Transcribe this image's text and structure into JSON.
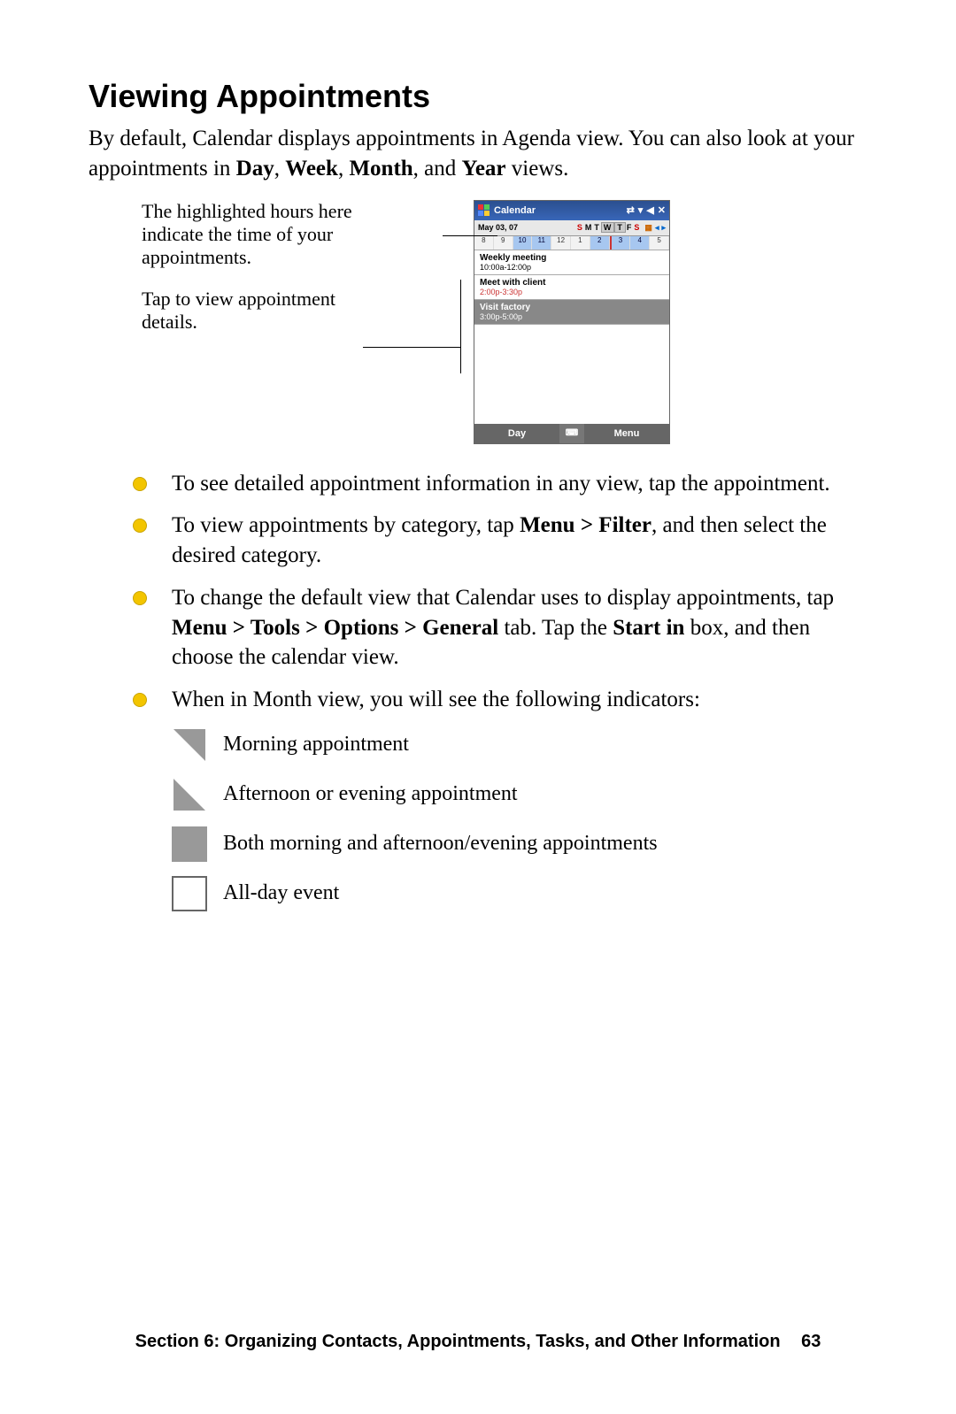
{
  "heading": "Viewing Appointments",
  "intro": {
    "pre": "By default, Calendar displays appointments in Agenda view. You can also look at your appointments in ",
    "b1": "Day",
    "c1": ", ",
    "b2": "Week",
    "c2": ", ",
    "b3": "Month",
    "c3": ", and ",
    "b4": "Year",
    "post": " views."
  },
  "callouts": {
    "a": "The highlighted hours here indicate the time of your appointments.",
    "b": "Tap to view appointment details."
  },
  "phone": {
    "title": "Calendar",
    "date": "May 03, 07",
    "dow": {
      "s1": "S",
      "m": "M",
      "t": "T",
      "w": "W",
      "t2": "T",
      "f": "F",
      "s2": "S"
    },
    "hours": [
      "8",
      "9",
      "10",
      "11",
      "12",
      "1",
      "2",
      "3",
      "4",
      "5"
    ],
    "appts": [
      {
        "title": "Weekly meeting",
        "time": "10:00a-12:00p",
        "sel": false,
        "red": false
      },
      {
        "title": "Meet with client",
        "time": "2:00p-3:30p",
        "sel": false,
        "red": true
      },
      {
        "title": "Visit factory",
        "time": "3:00p-5:00p",
        "sel": true,
        "red": false
      }
    ],
    "softLeft": "Day",
    "softRight": "Menu"
  },
  "bullets": {
    "i0": "To see detailed appointment information in any view, tap the appointment.",
    "i1": {
      "pre": "To view appointments by category, tap ",
      "b": "Menu > Filter",
      "post": ", and then select the desired category."
    },
    "i2": {
      "p1": "To change the default view that Calendar uses to display appointments, tap ",
      "b1": "Menu > Tools > Options > General",
      "p2": " tab. Tap the ",
      "b2": "Start in",
      "p3": " box, and then choose the calendar view."
    },
    "i3": "When in Month view, you will see the following indicators:"
  },
  "indicators": {
    "morning": "Morning appointment",
    "afternoon": "Afternoon or evening appointment",
    "both": "Both morning and afternoon/evening appointments",
    "allday": "All-day event"
  },
  "footer": {
    "section": "Section 6: Organizing Contacts, Appointments, Tasks, and Other Information",
    "page": "63"
  }
}
